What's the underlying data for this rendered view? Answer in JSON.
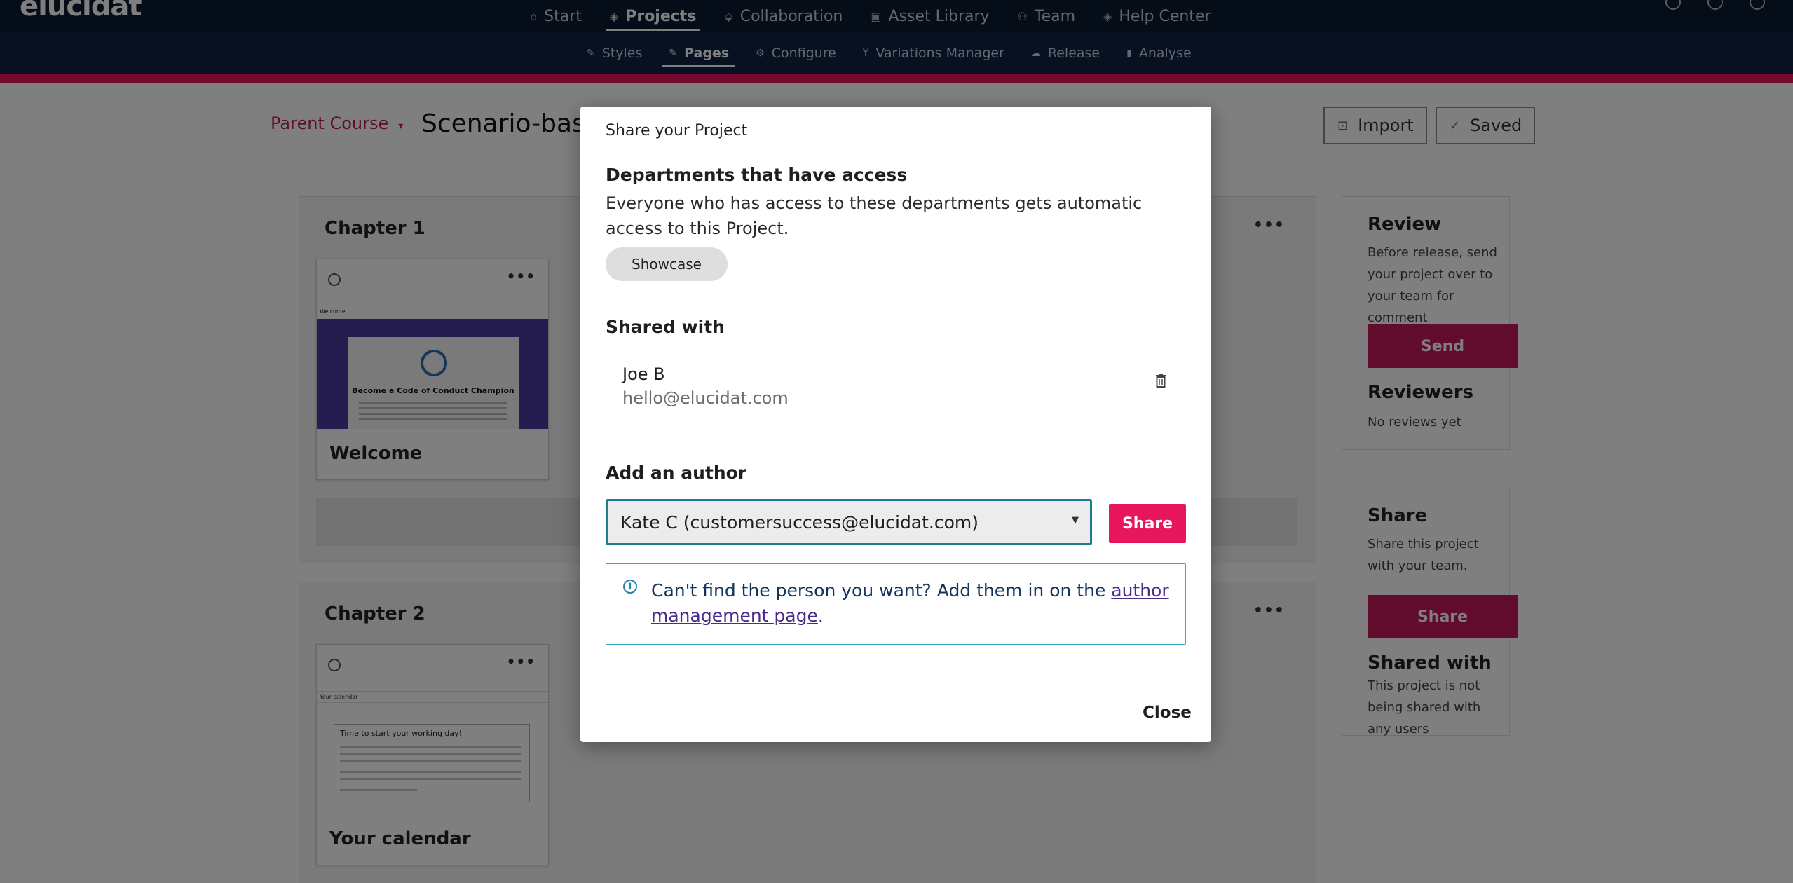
{
  "app": {
    "logo": "elucidat"
  },
  "main_nav": [
    {
      "label": "Start",
      "icon": "home-icon",
      "glyph": "⌂"
    },
    {
      "label": "Projects",
      "icon": "layers-icon",
      "glyph": "◈"
    },
    {
      "label": "Collaboration",
      "icon": "collaboration-icon",
      "glyph": "⬙"
    },
    {
      "label": "Asset Library",
      "icon": "image-icon",
      "glyph": "▣"
    },
    {
      "label": "Team",
      "icon": "team-icon",
      "glyph": "⚇"
    },
    {
      "label": "Help Center",
      "icon": "help-icon",
      "glyph": "◈"
    }
  ],
  "sub_nav": [
    {
      "label": "Styles",
      "icon": "brush-icon",
      "glyph": "✎"
    },
    {
      "label": "Pages",
      "icon": "pencil-icon",
      "glyph": "✎"
    },
    {
      "label": "Configure",
      "icon": "gear-icon",
      "glyph": "⚙"
    },
    {
      "label": "Variations Manager",
      "icon": "branch-icon",
      "glyph": "Y"
    },
    {
      "label": "Release",
      "icon": "cloud-icon",
      "glyph": "☁"
    },
    {
      "label": "Analyse",
      "icon": "chart-icon",
      "glyph": "▮"
    }
  ],
  "header": {
    "parent_course": "Parent Course",
    "project_title": "Scenario-based",
    "import_label": "Import",
    "saved_label": "Saved"
  },
  "chapters": [
    {
      "title": "Chapter 1",
      "page": {
        "name": "Welcome",
        "thumb_bar": "Welcome",
        "thumb_heading": "Become a Code of Conduct Champion"
      }
    },
    {
      "title": "Chapter 2",
      "page": {
        "name": "Your calendar",
        "thumb_bar": "Your calendar",
        "thumb_heading": "Time to start your working day!"
      }
    }
  ],
  "review_panel": {
    "title": "Review",
    "text": "Before release, send your project over to your team for comment",
    "button": "Send",
    "reviewers_title": "Reviewers",
    "reviewers_text": "No reviews yet"
  },
  "share_panel": {
    "title": "Share",
    "text": "Share this project with your team.",
    "button": "Share",
    "shared_title": "Shared with",
    "shared_text": "This project is not being shared with any users"
  },
  "modal": {
    "title": "Share your Project",
    "departments_heading": "Departments that have access",
    "departments_text": "Everyone who has access to these departments gets automatic access to this Project.",
    "department_chip": "Showcase",
    "shared_with_heading": "Shared with",
    "shared_user": {
      "name": "Joe B",
      "email": "hello@elucidat.com"
    },
    "add_author_heading": "Add an author",
    "author_select_value": "Kate C (customersuccess@elucidat.com)",
    "share_button": "Share",
    "info_text_before": "Can't find the person you want? Add them in on the ",
    "info_link": "author management page",
    "info_text_after": ".",
    "close_button": "Close"
  },
  "colors": {
    "nav_bg": "#0b1a33",
    "subnav_bg": "#0e2244",
    "accent_pink": "#e8175d",
    "panel_button": "#c2185b",
    "select_border": "#1c7d8c",
    "info_border": "#39a4c6"
  }
}
